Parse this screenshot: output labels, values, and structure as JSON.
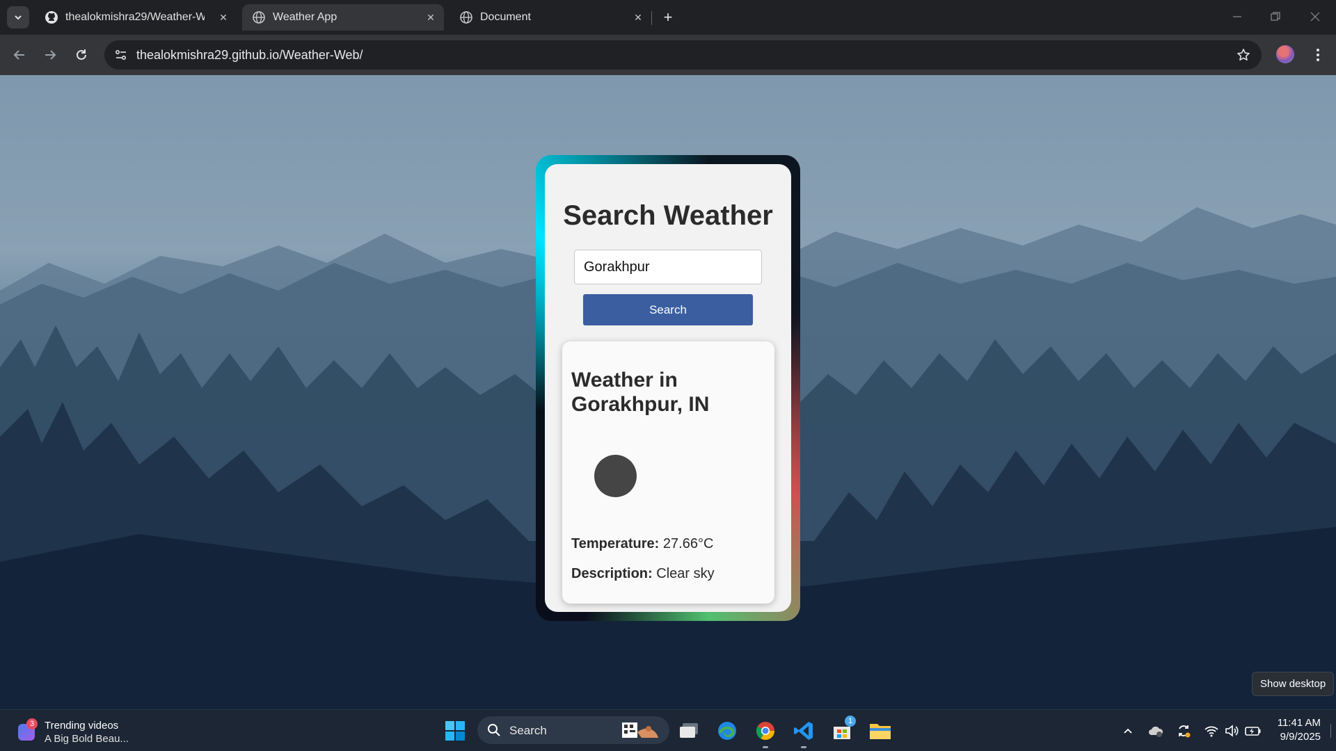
{
  "browser": {
    "tabs": [
      {
        "label": "thealokmishra29/Weather-Web",
        "icon": "github-icon",
        "active": false
      },
      {
        "label": "Weather App",
        "icon": "globe-icon",
        "active": true
      },
      {
        "label": "Document",
        "icon": "globe-icon",
        "active": false
      }
    ],
    "url": "thealokmishra29.github.io/Weather-Web/"
  },
  "app": {
    "title": "Search Weather",
    "search_value": "Gorakhpur",
    "search_button": "Search",
    "result": {
      "heading": "Weather in Gorakhpur, IN",
      "temperature_label": "Temperature:",
      "temperature_value": "27.66°C",
      "description_label": "Description:",
      "description_value": "Clear sky"
    },
    "colors": {
      "button": "#3b5ea0",
      "card": "#f2f2f2"
    }
  },
  "taskbar": {
    "widget_badge": "3",
    "widget_title": "Trending videos",
    "widget_subtitle": "A Big Bold Beau...",
    "search_label": "Search",
    "store_badge": "1",
    "time": "11:41 AM",
    "date": "9/9/2025",
    "show_desktop_tooltip": "Show desktop"
  }
}
